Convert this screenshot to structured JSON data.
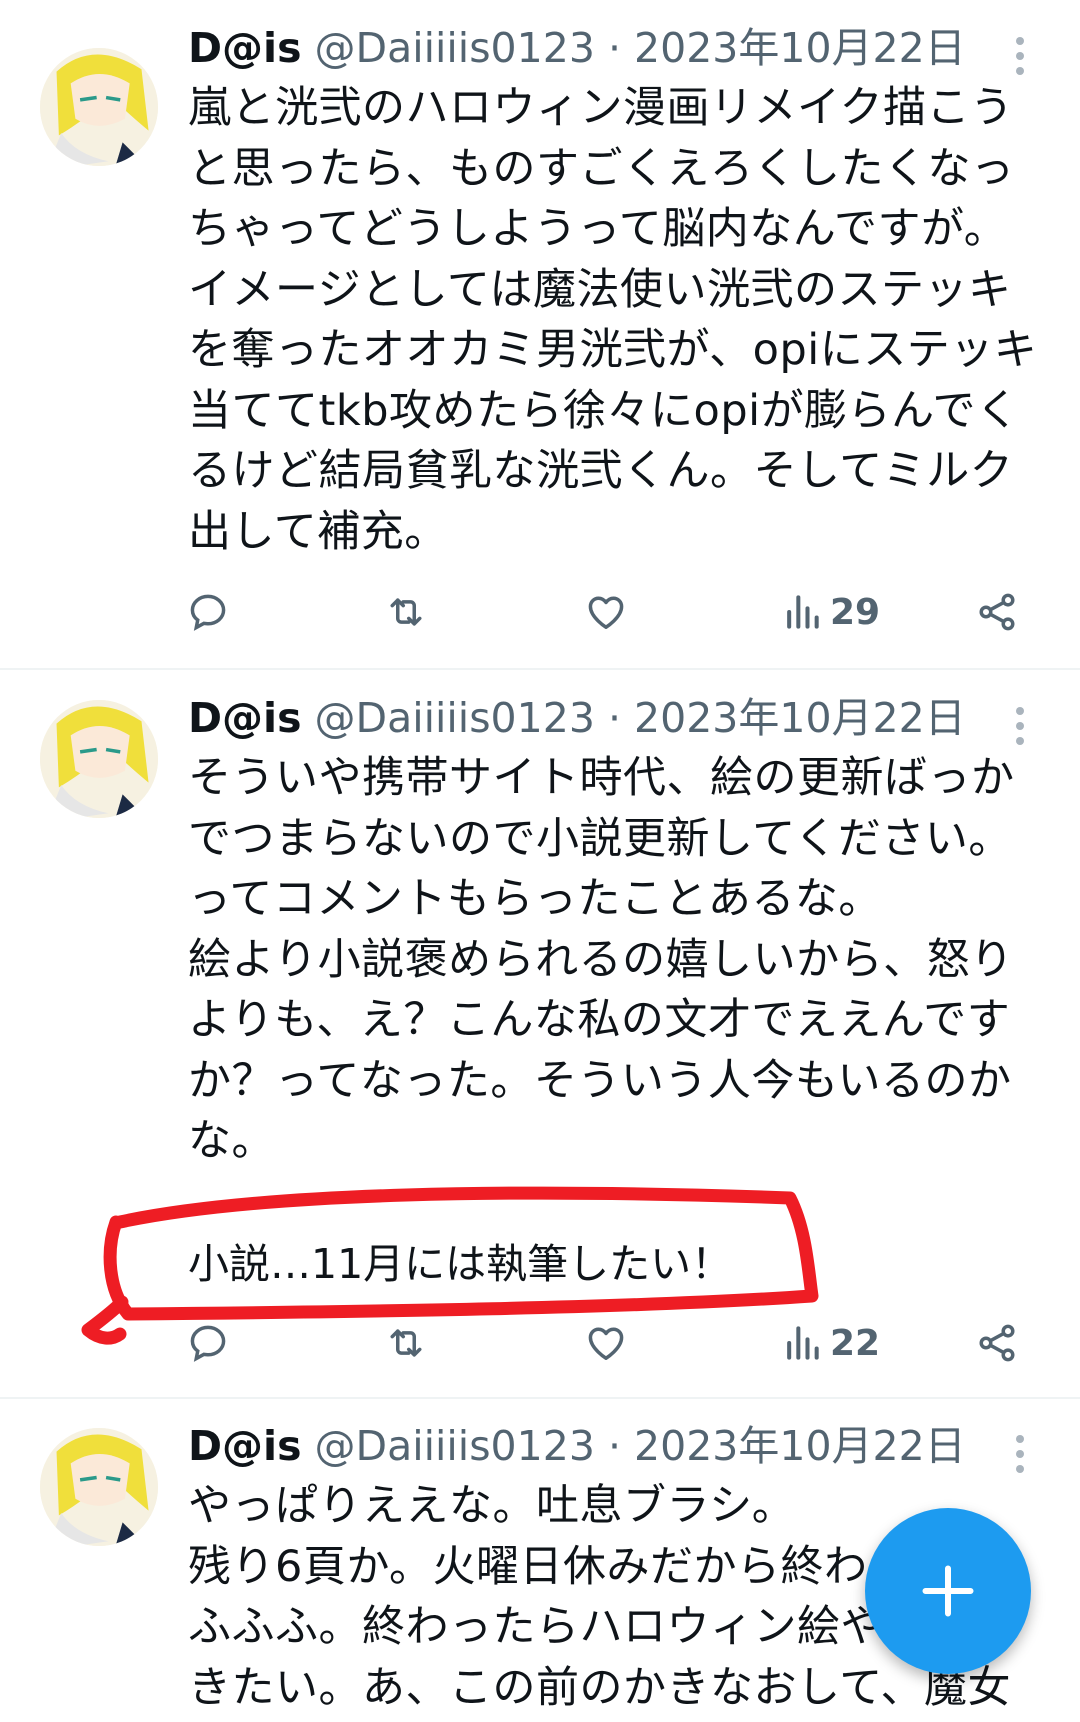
{
  "tweets": [
    {
      "name": "D@is",
      "handle": "@Daiiiiis0123",
      "date": "· 2023年10月22日",
      "text": "嵐と洸弐のハロウィン漫画リメイク描こう\nと思ったら、ものすごくえろくしたくなっ\nちゃってどうしようって脳内なんですが。\nイメージとしては魔法使い洸弐のステッキ\nを奪ったオオカミ男洸弐が、opiにステッキ\n当ててtkb攻めたら徐々にopiが膨らんでく\nるけど結局貧乳な洸弐くん。そしてミルク\n出して補充。",
      "views": "29"
    },
    {
      "name": "D@is",
      "handle": "@Daiiiiis0123",
      "date": "· 2023年10月22日",
      "text": "そういや携帯サイト時代、絵の更新ばっか\nでつまらないので小説更新してください。\nってコメントもらったことあるな。\n絵より小説褒められるの嬉しいから、怒り\nよりも、え？こんな私の文才でええんです\nか？ってなった。そういう人今もいるのか\nな。",
      "extra": "小説…11月には執筆したい！",
      "views": "22"
    },
    {
      "name": "D@is",
      "handle": "@Daiiiiis0123",
      "date": "· 2023年10月22日",
      "text": "やっぱりええな。吐息ブラシ。\n残り6頁か。火曜日休みだから終わる\nふふふ。終わったらハロウィン絵や\nきたい。あ、この前のかきなおして、魔女"
    }
  ],
  "icons": {
    "reply": "reply-icon",
    "retweet": "retweet-icon",
    "like": "heart-icon",
    "views": "views-icon",
    "share": "share-icon",
    "more": "more-vertical-icon",
    "compose": "plus-icon"
  },
  "colors": {
    "accent": "#1d9bf0",
    "annotation": "#ee1d24",
    "muted": "#536471"
  }
}
